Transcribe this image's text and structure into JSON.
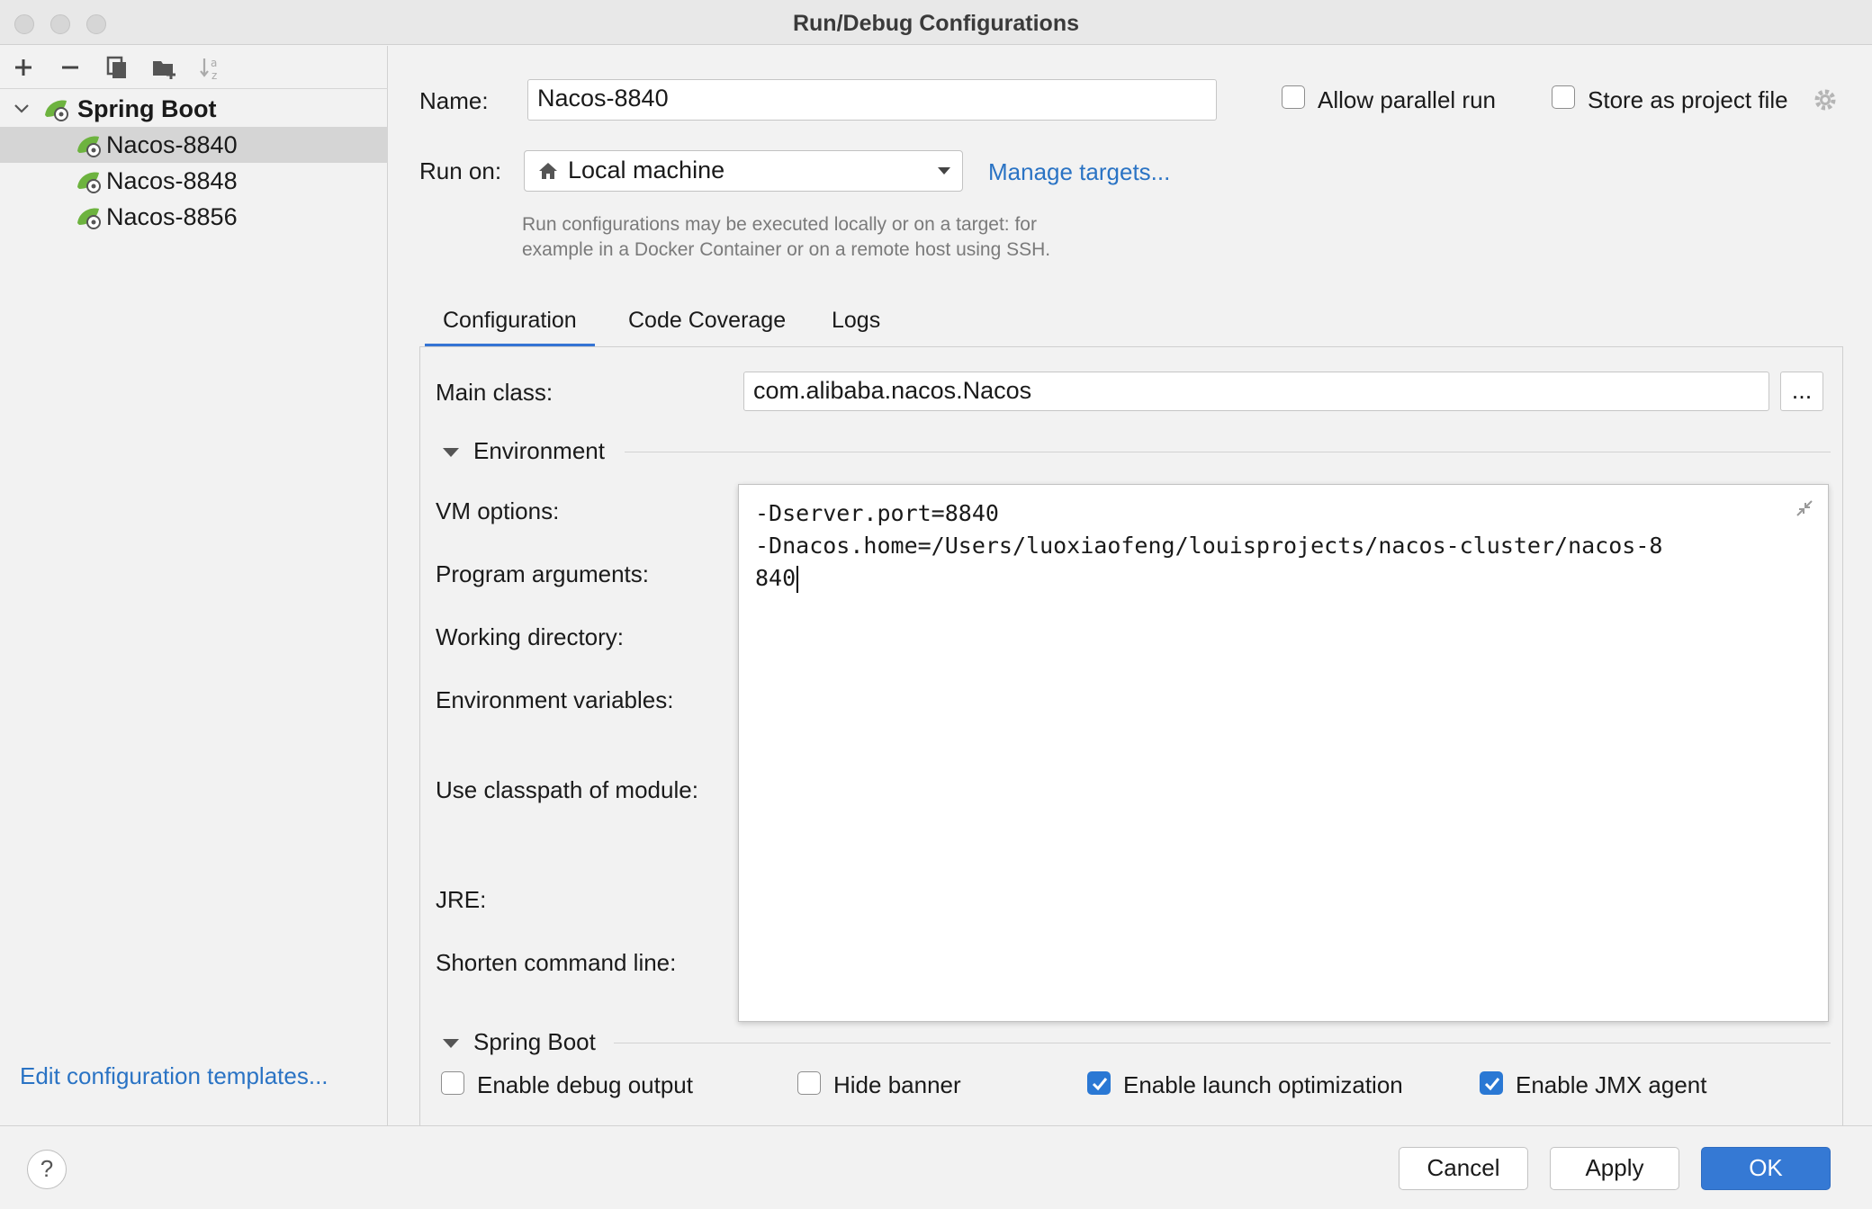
{
  "window": {
    "title": "Run/Debug Configurations"
  },
  "sidebar": {
    "toolbar_icons": [
      "add-icon",
      "remove-icon",
      "copy-icon",
      "folder-add-icon",
      "sort-alpha-icon"
    ],
    "tree": {
      "root_label": "Spring Boot",
      "children": [
        {
          "label": "Nacos-8840",
          "selected": true
        },
        {
          "label": "Nacos-8848",
          "selected": false
        },
        {
          "label": "Nacos-8856",
          "selected": false
        }
      ]
    },
    "edit_templates_link": "Edit configuration templates..."
  },
  "form": {
    "name_label": "Name:",
    "name_value": "Nacos-8840",
    "allow_parallel_label": "Allow parallel run",
    "allow_parallel_checked": false,
    "store_project_label": "Store as project file",
    "store_project_checked": false,
    "run_on_label": "Run on:",
    "run_on_value": "Local machine",
    "manage_targets_link": "Manage targets...",
    "hint_line1": "Run configurations may be executed locally or on a target: for",
    "hint_line2": "example in a Docker Container or on a remote host using SSH."
  },
  "tabs": [
    {
      "label": "Configuration",
      "active": true
    },
    {
      "label": "Code Coverage",
      "active": false
    },
    {
      "label": "Logs",
      "active": false
    }
  ],
  "configuration": {
    "main_class_label": "Main class:",
    "main_class_value": "com.alibaba.nacos.Nacos",
    "browse_button": "...",
    "environment_header": "Environment",
    "vm_options_label": "VM options:",
    "program_arguments_label": "Program arguments:",
    "working_directory_label": "Working directory:",
    "env_variables_label": "Environment variables:",
    "classpath_module_label": "Use classpath of module:",
    "jre_label": "JRE:",
    "shorten_cmd_label": "Shorten command line:",
    "vm_options_lines": [
      "-Dserver.port=8840",
      "-Dnacos.home=/Users/luoxiaofeng/louisprojects/nacos-cluster/nacos-8",
      "840"
    ],
    "spring_boot_header": "Spring Boot",
    "checkboxes": [
      {
        "label": "Enable debug output",
        "checked": false
      },
      {
        "label": "Hide banner",
        "checked": false
      },
      {
        "label": "Enable launch optimization",
        "checked": true
      },
      {
        "label": "Enable JMX agent",
        "checked": true
      }
    ]
  },
  "footer": {
    "help": "?",
    "cancel": "Cancel",
    "apply": "Apply",
    "ok": "OK"
  },
  "colors": {
    "accent": "#3579d4",
    "link": "#2a73c4",
    "spring_green": "#6db33f"
  }
}
